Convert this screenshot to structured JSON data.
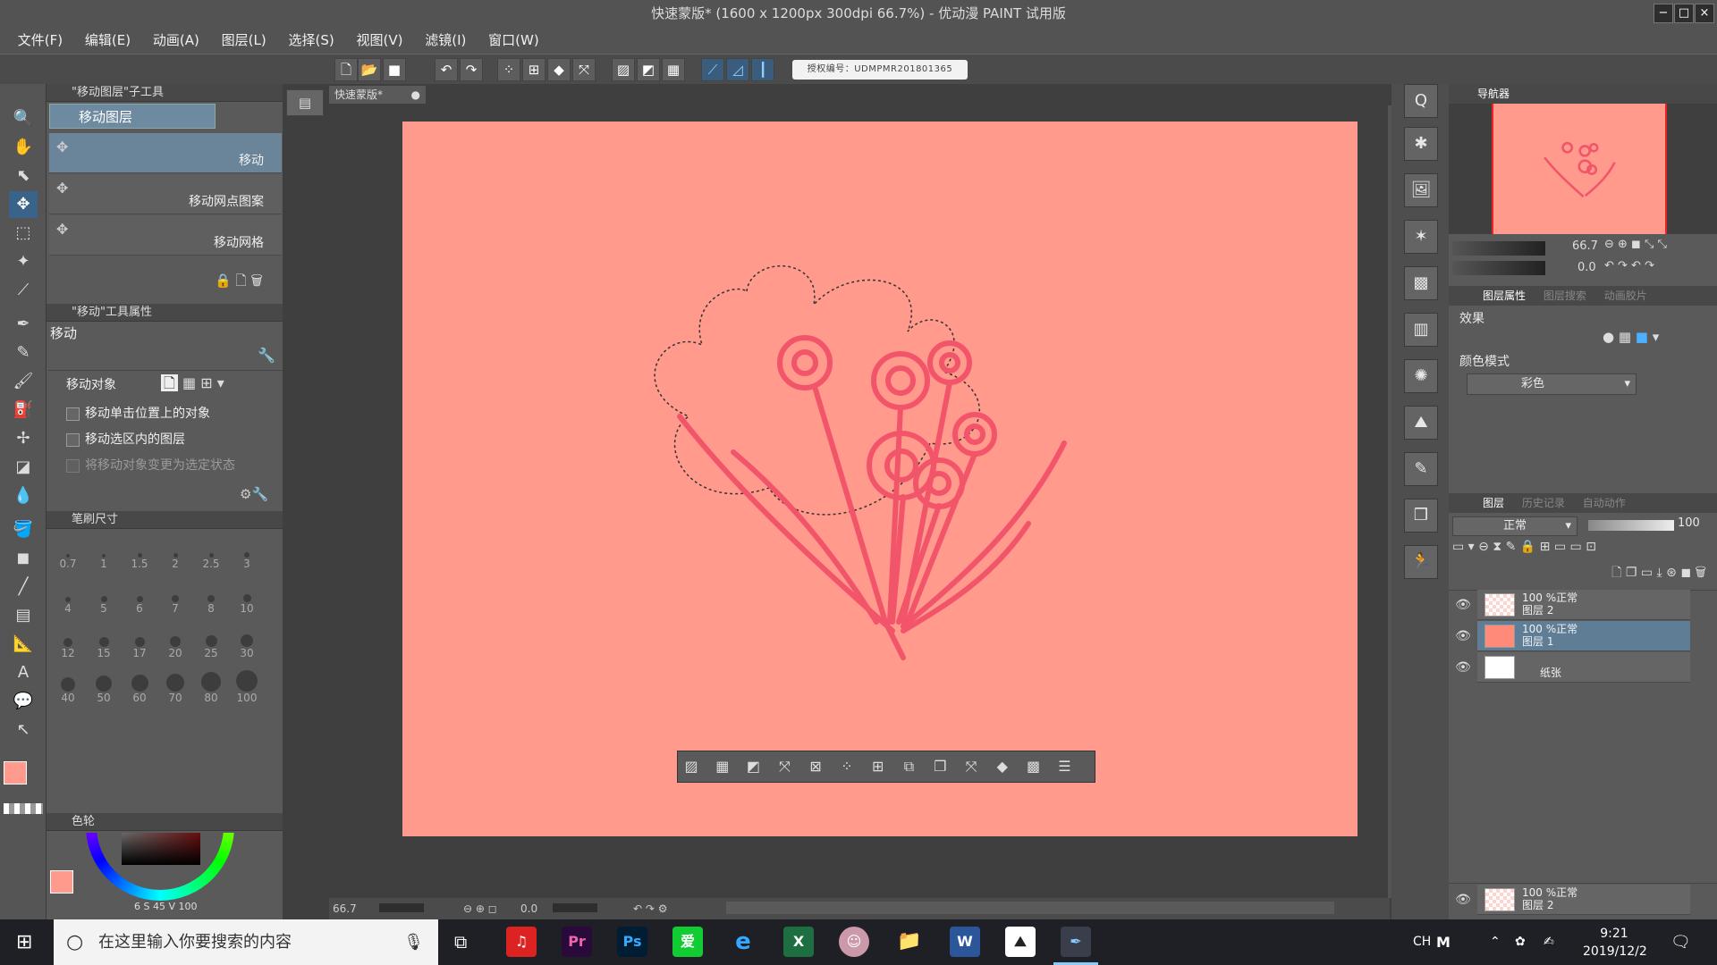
{
  "window": {
    "title": "快速蒙版* (1600 x 1200px 300dpi 66.7%) - 优动漫 PAINT 试用版",
    "min": "−",
    "max": "□",
    "close": "×"
  },
  "menu": [
    "文件(F)",
    "编辑(E)",
    "动画(A)",
    "图层(L)",
    "选择(S)",
    "视图(V)",
    "滤镜(I)",
    "窗口(W)"
  ],
  "toolbar": {
    "license": "授权编号：UDMPMR201801365"
  },
  "left": {
    "subtool_header": "\"移动图层\"子工具",
    "group_name": "移动图层",
    "subtools": [
      "移动",
      "移动网点图案",
      "移动网格"
    ],
    "props_header": "\"移动\"工具属性",
    "props_title": "移动",
    "move_target_label": "移动对象",
    "options": [
      "移动单击位置上的对象",
      "移动选区内的图层",
      "将移动对象变更为选定状态"
    ],
    "brush_header": "笔刷尺寸",
    "brush_sizes": [
      "0.7",
      "1",
      "1.5",
      "2",
      "2.5",
      "3",
      "4",
      "5",
      "6",
      "7",
      "8",
      "10",
      "12",
      "15",
      "17",
      "20",
      "25",
      "30",
      "40",
      "50",
      "60",
      "70",
      "80",
      "100"
    ],
    "color_header": "色轮",
    "color_values": {
      "s": "6",
      "s_label": "S",
      "v": "45",
      "v_label": "V",
      "extra": "100"
    }
  },
  "canvas": {
    "doc_tab": "快速蒙版*",
    "zoom": "66.7",
    "angle": "0.0"
  },
  "right": {
    "nav_tab": "导航器",
    "nav_zoom": "66.7",
    "nav_angle": "0.0",
    "prop_tabs": [
      "图层属性",
      "图层搜索",
      "动画胶片"
    ],
    "effect_label": "效果",
    "color_mode_label": "颜色模式",
    "color_mode_value": "彩色",
    "layer_tabs": [
      "图层",
      "历史记录",
      "自动动作"
    ],
    "blend_mode": "正常",
    "opacity": "100",
    "layers": [
      {
        "line1": "100 %正常",
        "line2": "图层 2"
      },
      {
        "line1": "100 %正常",
        "line2": "图层 1"
      },
      {
        "line1": "",
        "line2": "纸张"
      }
    ],
    "bottom_layer": {
      "line1": "100 %正常",
      "line2": "图层 2"
    }
  },
  "taskbar": {
    "search_placeholder": "在这里输入你要搜索的内容",
    "ime": "CH",
    "ime2": "M",
    "time": "9:21",
    "date": "2019/12/2"
  },
  "colors": {
    "canvas": "#ff9a8c",
    "sketch": "#f2556a",
    "accent": "#3a6389"
  }
}
